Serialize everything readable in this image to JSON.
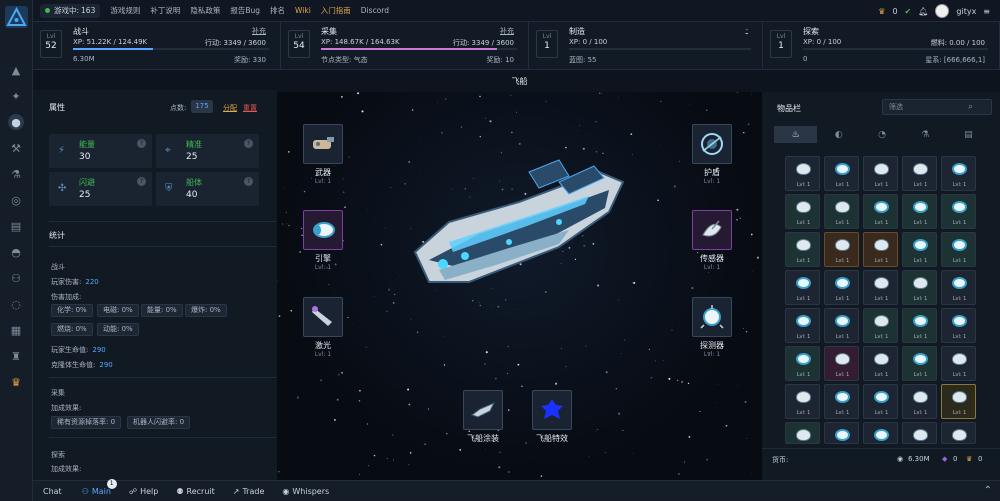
{
  "topbar": {
    "online_label": "游戏中:",
    "online_count": "163",
    "links": [
      "游戏规则",
      "补丁说明",
      "隐私政策",
      "报告Bug",
      "排名",
      "Wiki",
      "入门指南",
      "Discord"
    ],
    "crown_count": "0",
    "username": "gityx"
  },
  "skills": [
    {
      "lvl_label": "Lvl",
      "level": "52",
      "name": "战斗",
      "link": "补充",
      "xp": "XP: 51.22K / 124.49K",
      "right1": "行动: 3349 / 3600",
      "bottom_left": "6.30M",
      "bottom_right": "奖励:",
      "bottom_right_val": "330",
      "progress": 0.41
    },
    {
      "lvl_label": "Lvl",
      "level": "54",
      "name": "采集",
      "link": "补充",
      "xp": "XP: 148.67K / 164.63K",
      "right1": "行动: 3349 / 3600",
      "bottom_left": "节点类型: 气态",
      "bottom_right": "奖励:",
      "bottom_right_val": "10",
      "progress": 0.9
    },
    {
      "lvl_label": "Lvl",
      "level": "1",
      "name": "制造",
      "link": "-",
      "xp": "XP: 0 / 100",
      "right1": "",
      "bottom_left": "蓝图: 55",
      "bottom_right": "",
      "bottom_right_val": "",
      "progress": 0
    },
    {
      "lvl_label": "Lvl",
      "level": "1",
      "name": "探索",
      "link": "",
      "xp": "XP: 0 / 100",
      "right1": "燃料: 0.00 / 100",
      "bottom_left": "0",
      "bottom_right": "星系: [666,666,1]",
      "bottom_right_val": "",
      "progress": 0
    }
  ],
  "panel_title": "飞船",
  "attributes": {
    "title": "属性",
    "points_label": "点数:",
    "points": "175",
    "allocate": "分配",
    "reset": "重置",
    "cards": [
      {
        "name": "能量",
        "value": "30",
        "icon": "lightning-icon"
      },
      {
        "name": "精准",
        "value": "25",
        "icon": "crosshair-icon"
      },
      {
        "name": "闪避",
        "value": "25",
        "icon": "dodge-icon"
      },
      {
        "name": "船体",
        "value": "40",
        "icon": "shield-icon"
      }
    ]
  },
  "stats": {
    "title": "统计",
    "combat_title": "战斗",
    "player_dmg_label": "玩家伤害:",
    "player_dmg": "220",
    "dmg_bonus_label": "伤害加成:",
    "dmg_chips": [
      "化学: 0%",
      "电磁: 0%",
      "能量: 0%",
      "爆炸: 0%",
      "燃烧: 0%",
      "动能: 0%"
    ],
    "player_hp_label": "玩家生命值:",
    "player_hp": "290",
    "clone_hp_label": "克隆体生命值:",
    "clone_hp": "290",
    "gather_title": "采集",
    "bonus_label": "加成效果:",
    "gather_chips": [
      "稀有资源掉落率: 0",
      "机器人闪避率: 0"
    ],
    "explore_title": "探索",
    "explore_bonus_label": "加成效果:"
  },
  "slots": [
    {
      "name": "武器",
      "lvl": "Lvl: 1"
    },
    {
      "name": "引擎",
      "lvl": "Lvl: 1"
    },
    {
      "name": "激光",
      "lvl": "Lvl: 1"
    },
    {
      "name": "护盾",
      "lvl": "Lvl: 1"
    },
    {
      "name": "传感器",
      "lvl": "Lvl: 1"
    },
    {
      "name": "探测器",
      "lvl": "Lvl: 1"
    },
    {
      "name": "飞船涂装",
      "lvl": ""
    },
    {
      "name": "飞船特效",
      "lvl": ""
    }
  ],
  "inventory": {
    "title": "物品栏",
    "search_placeholder": "筛选",
    "tabs": [
      "flame-icon",
      "egg-icon",
      "pie-icon",
      "flask-icon",
      "document-icon"
    ],
    "cell_lvl": "Lvl: 1",
    "currency_label": "货币:",
    "currency_value": "6.30M",
    "gem_value": "0",
    "crown_value": "0"
  },
  "chat": {
    "tabs": [
      "Chat",
      "Main",
      "Help",
      "Recruit",
      "Trade",
      "Whispers"
    ],
    "main_badge": "1"
  },
  "colors": {
    "accent": "#58a6ff",
    "green": "#3fb950",
    "orange": "#e3a64a",
    "bg": "#0d1117"
  }
}
